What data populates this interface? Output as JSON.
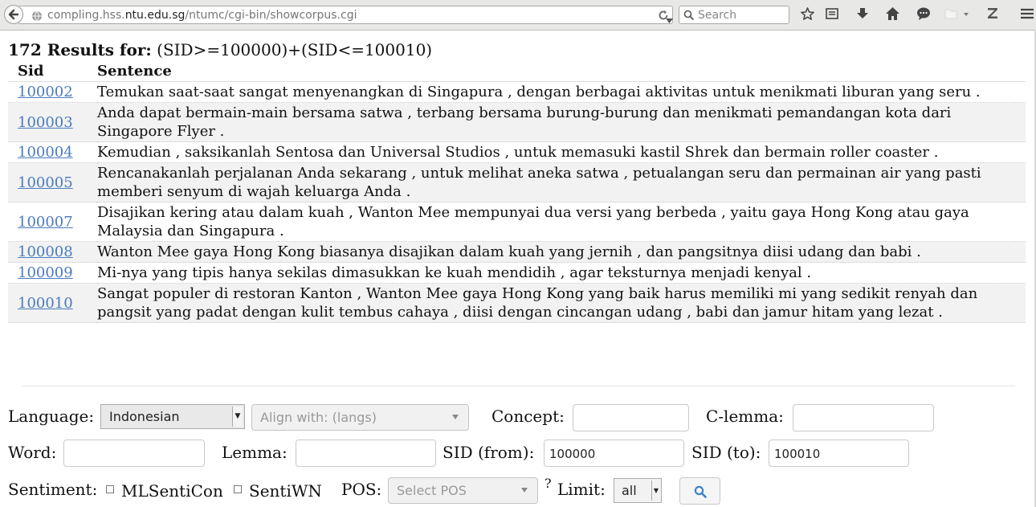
{
  "browser": {
    "url_prefix": "compling.hss.",
    "url_domain": "ntu.edu.sg",
    "url_path": "/ntumc/cgi-bin/showcorpus.cgi",
    "search_placeholder": "Search"
  },
  "results": {
    "count_label": "172 Results for:",
    "query": "(SID>=100000)+(SID<=100010)",
    "headers": {
      "sid": "Sid",
      "sentence": "Sentence"
    },
    "rows": [
      {
        "sid": "100002",
        "sentence": "Temukan saat-saat sangat menyenangkan di Singapura , dengan berbagai aktivitas untuk menikmati liburan yang seru ."
      },
      {
        "sid": "100003",
        "sentence": "Anda dapat bermain-main bersama satwa , terbang bersama burung-burung dan menikmati pemandangan kota dari Singapore Flyer ."
      },
      {
        "sid": "100004",
        "sentence": "Kemudian , saksikanlah Sentosa dan Universal Studios , untuk memasuki kastil Shrek dan bermain roller coaster ."
      },
      {
        "sid": "100005",
        "sentence": "Rencanakanlah perjalanan Anda sekarang , untuk melihat aneka satwa , petualangan seru dan permainan air yang pasti memberi senyum di wajah keluarga Anda ."
      },
      {
        "sid": "100007",
        "sentence": "Disajikan kering atau dalam kuah , Wanton Mee mempunyai dua versi yang berbeda , yaitu gaya Hong Kong atau gaya Malaysia dan Singapura ."
      },
      {
        "sid": "100008",
        "sentence": "Wanton Mee gaya Hong Kong biasanya disajikan dalam kuah yang jernih , dan pangsitnya diisi udang dan babi ."
      },
      {
        "sid": "100009",
        "sentence": "Mi-nya yang tipis hanya sekilas dimasukkan ke kuah mendidih , agar teksturnya menjadi kenyal ."
      },
      {
        "sid": "100010",
        "sentence": "Sangat populer di restoran Kanton , Wanton Mee gaya Hong Kong yang baik harus memiliki mi yang sedikit renyah dan pangsit yang padat dengan kulit tembus cahaya , diisi dengan cincangan udang , babi dan jamur hitam yang lezat ."
      }
    ]
  },
  "form": {
    "language_label": "Language:",
    "language_value": "Indonesian",
    "align_placeholder": "Align with: (langs)",
    "concept_label": "Concept:",
    "clemma_label": "C-lemma:",
    "word_label": "Word:",
    "lemma_label": "Lemma:",
    "sid_from_label": "SID (from):",
    "sid_from_value": "100000",
    "sid_to_label": "SID (to):",
    "sid_to_value": "100010",
    "sentiment_label": "Sentiment:",
    "mlsenticon_label": "MLSentiCon",
    "sentiwn_label": "SentiWN",
    "pos_label": "POS:",
    "pos_placeholder": "Select POS",
    "help_mark": "?",
    "limit_label": "Limit:",
    "limit_value": "all"
  },
  "colors": {
    "link": "#4a7bbd",
    "row_alt": "#f2f2f2",
    "toolbar": "#e8e8e6"
  },
  "icons": [
    "back-arrow-icon",
    "globe-icon",
    "dropdown-icon",
    "reload-icon",
    "search-icon",
    "bookmark-star-icon",
    "reading-list-icon",
    "download-icon",
    "home-icon",
    "chat-icon",
    "folder-icon",
    "zotero-icon",
    "menu-icon"
  ]
}
